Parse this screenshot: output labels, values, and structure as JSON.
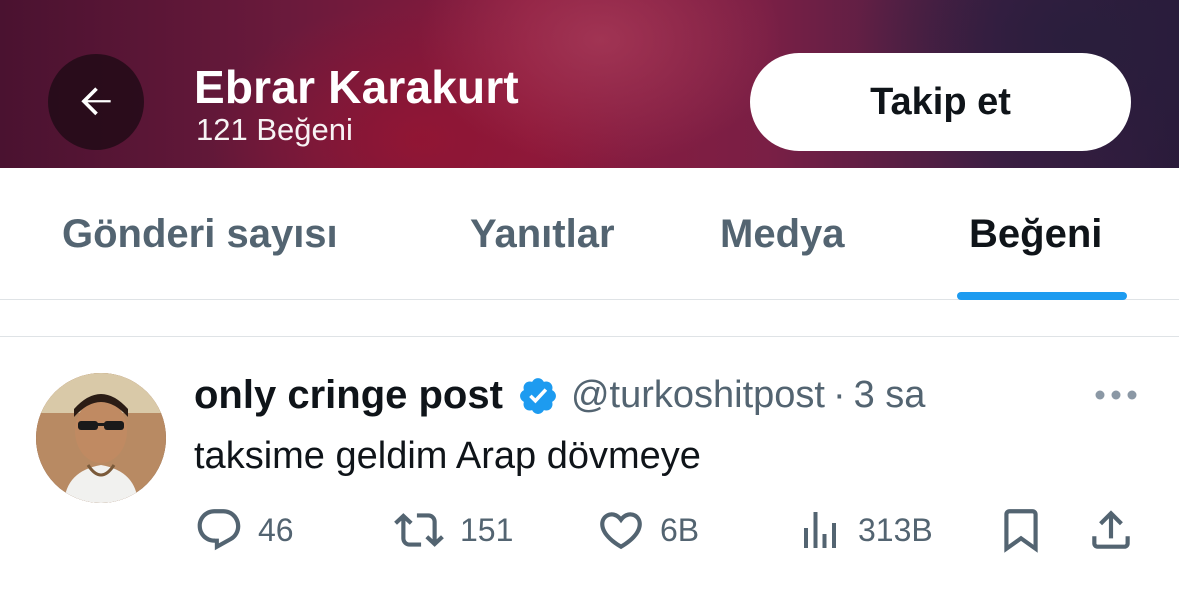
{
  "header": {
    "title": "Ebrar Karakurt",
    "subtitle": "121 Beğeni",
    "follow_label": "Takip et",
    "back_icon": "arrow-left-icon"
  },
  "tabs": [
    {
      "label": "Gönderi sayısı",
      "active": false
    },
    {
      "label": "Yanıtlar",
      "active": false
    },
    {
      "label": "Medya",
      "active": false
    },
    {
      "label": "Beğeni",
      "active": true
    }
  ],
  "post": {
    "author_name": "only cringe post",
    "handle": "@turkoshitpost",
    "separator": "·",
    "time": "3 sa",
    "text": "taksime geldim Arap dövmeye",
    "actions": {
      "replies": "46",
      "reposts": "151",
      "likes": "6B",
      "views": "313B"
    }
  },
  "colors": {
    "accent": "#1d9bf0",
    "text_primary": "#0f1419",
    "text_secondary": "#536471",
    "verified": "#1d9bf0"
  }
}
